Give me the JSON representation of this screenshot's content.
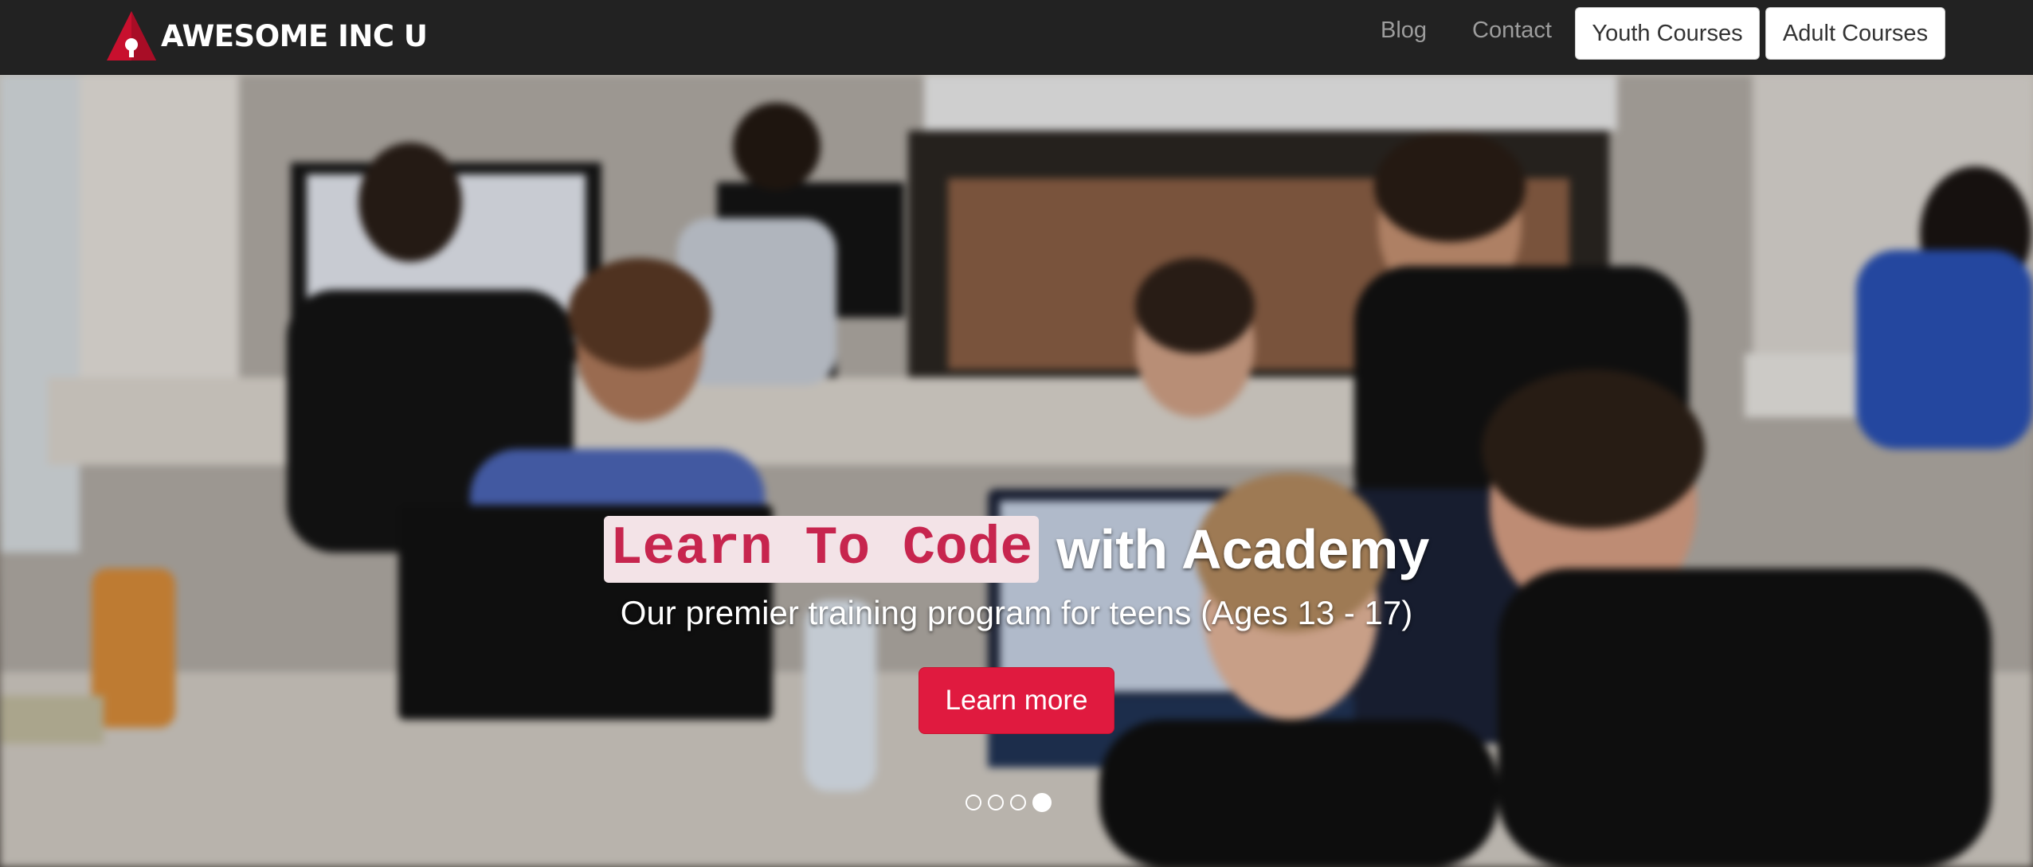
{
  "navbar": {
    "brand": "AWESOME INC U",
    "logo_icon": "red-triangle-lightbulb-icon",
    "links": [
      {
        "label": "Blog"
      },
      {
        "label": "Contact"
      }
    ],
    "buttons": [
      {
        "label": "Youth Courses"
      },
      {
        "label": "Adult Courses"
      }
    ]
  },
  "hero": {
    "headline_code": "Learn To Code",
    "headline_rest": "with Academy",
    "subtitle": "Our premier training program for teens (Ages 13 - 17)",
    "cta_label": "Learn more",
    "slides_total": 4,
    "active_slide": 4
  },
  "colors": {
    "navbar_bg": "#222222",
    "accent": "#e01a3f",
    "code_text": "#c7254e",
    "code_bg": "#f3e3e7"
  }
}
